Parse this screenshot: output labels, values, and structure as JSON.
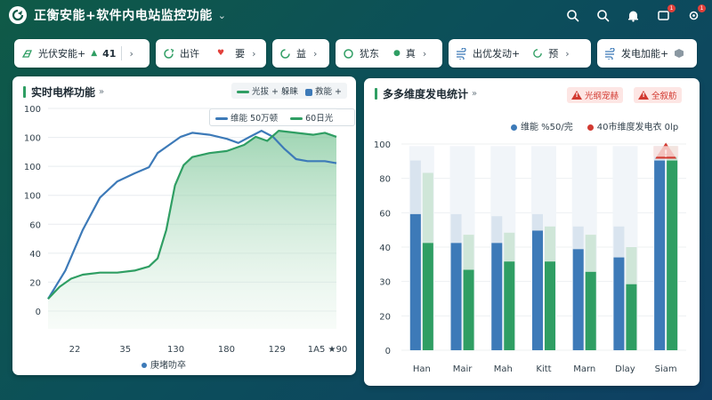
{
  "header": {
    "title": "正衡安能+软件内电站监控功能",
    "title_caret": "⌄",
    "actions": [
      {
        "icon": "search-icon"
      },
      {
        "icon": "zoom-icon"
      },
      {
        "icon": "bell-icon"
      },
      {
        "icon": "message-icon",
        "badge": "1"
      },
      {
        "icon": "settings-icon",
        "badge": "1"
      }
    ]
  },
  "toolbar": {
    "chips": [
      {
        "icon": "solar-panel-icon",
        "label": "光伏安能+",
        "value": "41"
      },
      {
        "icon": "refresh-icon",
        "label": "出许",
        "extra": "要"
      },
      {
        "icon": "cycle-icon",
        "label": "益"
      },
      {
        "icon": "circle-icon",
        "label": "犹东",
        "extra": "真"
      },
      {
        "icon": "wind-icon",
        "label": "出优发动+",
        "extra": "预"
      },
      {
        "icon": "wind-icon",
        "label": "发电加能+"
      }
    ]
  },
  "left_panel": {
    "title": "实时电桦功能",
    "legend_top": [
      "光拔 + 躲睐",
      "救能 +"
    ],
    "inner_legend": [
      "维能  50万顿",
      "60日光"
    ],
    "x_footer": "庚堵叻卒"
  },
  "right_panel": {
    "title": "多多维度发电统计",
    "alerts": [
      "光纲宠赫",
      "全叙舫"
    ],
    "legend": [
      "维能  %50/完",
      "40市维度发电衣 0lp"
    ]
  },
  "colors": {
    "green": "#2f9e63",
    "blue": "#3d7ab8",
    "light_green": "#cfe6d8",
    "light_blue": "#d9e4ef",
    "alert": "#d23a31"
  },
  "chart_data": [
    {
      "type": "line",
      "ylim": [
        0,
        100
      ],
      "y_tick_labels": [
        "0",
        "20",
        "40",
        "60",
        "100",
        "100",
        "100",
        "100"
      ],
      "x_tick_labels": [
        "22",
        "35",
        "130",
        "180",
        "129",
        "1A5 ★90"
      ],
      "series": [
        {
          "name": "光拔 + 躲睐",
          "color": "#2f9e63",
          "values": [
            [
              0,
              6
            ],
            [
              4,
              12
            ],
            [
              8,
              16
            ],
            [
              12,
              18
            ],
            [
              18,
              19
            ],
            [
              24,
              19
            ],
            [
              30,
              20
            ],
            [
              35,
              22
            ],
            [
              38,
              26
            ],
            [
              41,
              40
            ],
            [
              44,
              62
            ],
            [
              47,
              72
            ],
            [
              50,
              76
            ],
            [
              56,
              78
            ],
            [
              62,
              79
            ],
            [
              68,
              82
            ],
            [
              72,
              86
            ],
            [
              76,
              84
            ],
            [
              80,
              89
            ],
            [
              86,
              88
            ],
            [
              92,
              87
            ],
            [
              96,
              88
            ],
            [
              100,
              86
            ]
          ]
        },
        {
          "name": "救能 +",
          "color": "#3d7ab8",
          "values": [
            [
              0,
              6
            ],
            [
              6,
              20
            ],
            [
              12,
              40
            ],
            [
              18,
              56
            ],
            [
              24,
              64
            ],
            [
              30,
              68
            ],
            [
              35,
              71
            ],
            [
              38,
              78
            ],
            [
              42,
              82
            ],
            [
              46,
              86
            ],
            [
              50,
              88
            ],
            [
              56,
              87
            ],
            [
              62,
              85
            ],
            [
              66,
              83
            ],
            [
              70,
              86
            ],
            [
              74,
              89
            ],
            [
              78,
              86
            ],
            [
              82,
              80
            ],
            [
              86,
              75
            ],
            [
              90,
              74
            ],
            [
              96,
              74
            ],
            [
              100,
              73
            ]
          ]
        }
      ]
    },
    {
      "type": "bar",
      "ylim": [
        0,
        100
      ],
      "y_tick_labels": [
        "0",
        "20",
        "30",
        "40",
        "60",
        "80",
        "100"
      ],
      "categories": [
        "Han",
        "Mair",
        "Mah",
        "Kitt",
        "Marn",
        "Dlay",
        "Siam"
      ],
      "series": [
        {
          "name": "维能  %50/完",
          "color": "#3d7ab8",
          "values": [
            66,
            52,
            52,
            58,
            49,
            45,
            92
          ]
        },
        {
          "name": "40市维度发电衣 0lp",
          "color": "#2f9e63",
          "values": [
            52,
            39,
            43,
            43,
            38,
            32,
            92
          ]
        }
      ],
      "background_values": [
        99,
        99,
        99,
        99,
        99,
        99,
        99
      ],
      "ghost_series": [
        {
          "color": "#d9e4ef",
          "values": [
            92,
            66,
            65,
            66,
            60,
            60,
            99
          ]
        },
        {
          "color": "#cfe6d8",
          "values": [
            86,
            56,
            57,
            60,
            56,
            50,
            99
          ]
        }
      ],
      "warning_on": "Siam"
    }
  ]
}
